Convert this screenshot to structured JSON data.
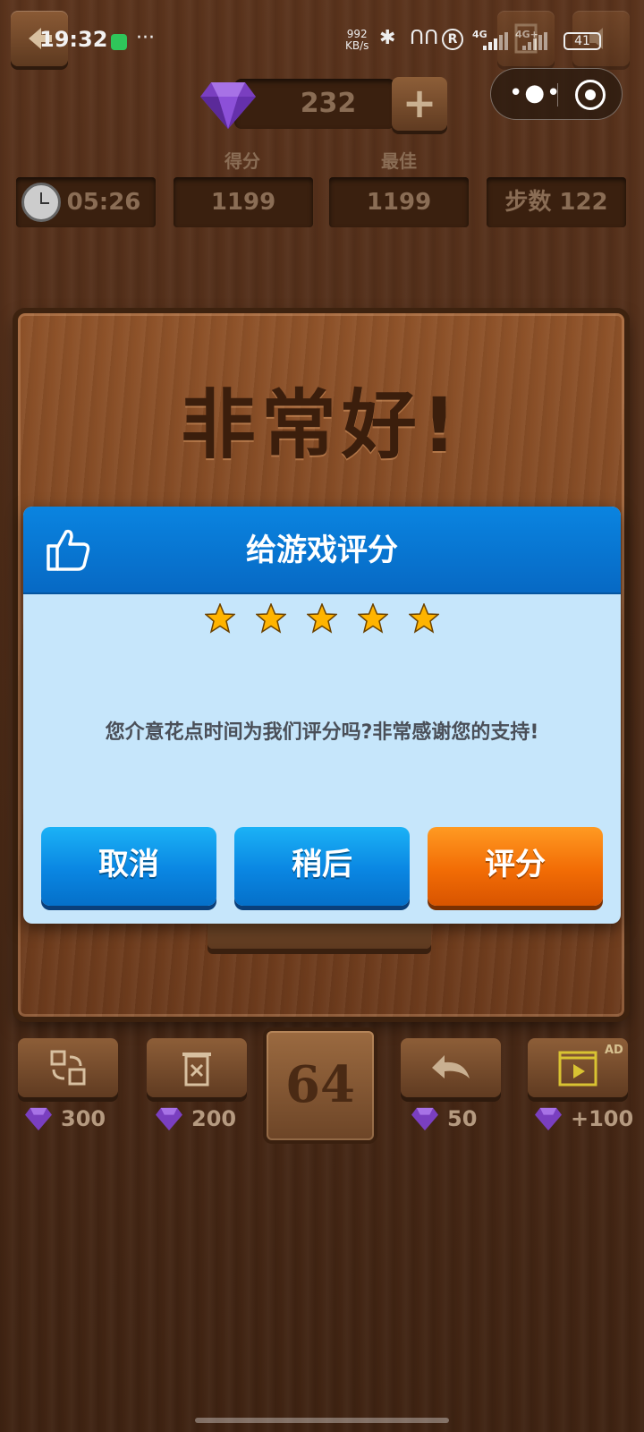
{
  "status_bar": {
    "time": "19:32",
    "more": "···",
    "net_speed_value": "992",
    "net_speed_unit": "KB/s",
    "sig1_label": "4G",
    "sig2_label": "4G+",
    "battery": "41",
    "r_mark": "R"
  },
  "header": {
    "gems": "232",
    "plus_label": "+",
    "score_label": "得分",
    "best_label": "最佳",
    "timer": "05:26",
    "score": "1199",
    "best": "1199",
    "steps": "步数 122"
  },
  "board": {
    "title": "非常好!"
  },
  "dialog": {
    "title": "给游戏评分",
    "star_count": 5,
    "message": "您介意花点时间为我们评分吗?非常感谢您的支持!",
    "cancel_label": "取消",
    "later_label": "稍后",
    "rate_label": "评分"
  },
  "toolbar": {
    "shuffle_cost": "300",
    "delete_cost": "200",
    "next_tile": "64",
    "undo_cost": "50",
    "video_reward": "+100",
    "ad_tag": "AD"
  },
  "colors": {
    "dialog_header": "#0a84e0",
    "dialog_body": "#c6e6fb",
    "blue_button": "#0a86e2",
    "orange_button": "#f26c05",
    "wood_dark": "#3a200f",
    "gem_purple": "#7a3fc0"
  }
}
